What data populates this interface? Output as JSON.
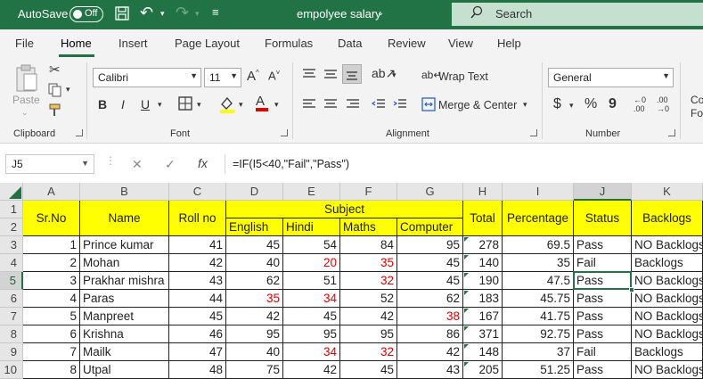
{
  "titlebar": {
    "autosave": "AutoSave",
    "toggle": "Off",
    "title": "empolyee salary",
    "search": "Search"
  },
  "menu": [
    "File",
    "Home",
    "Insert",
    "Page Layout",
    "Formulas",
    "Data",
    "Review",
    "View",
    "Help"
  ],
  "ribbon": {
    "paste": "Paste",
    "clipboard": "Clipboard",
    "font_name": "Calibri",
    "font_size": "11",
    "font_label": "Font",
    "wrap_text": "Wrap Text",
    "merge_center": "Merge & Center",
    "alignment_label": "Alignment",
    "number_format": "General",
    "number_label": "Number",
    "cond_fmt": "Co\nFor",
    "bold": "B",
    "italic": "I",
    "underline": "U",
    "font_color_a": "A",
    "grow_font": "A^",
    "shrink_font": "A˅",
    "currency": "$",
    "percent": "%",
    "comma": "9",
    "inc_dec": ".00",
    "dec_dec": ".00",
    "colors": {
      "highlight": "#ffff00",
      "font_red": "#e00000"
    }
  },
  "formula_bar": {
    "name_box": "J5",
    "formula": "=IF(I5<40,\"Fail\",\"Pass\")",
    "fx": "fx"
  },
  "columns": [
    "A",
    "B",
    "C",
    "D",
    "E",
    "F",
    "G",
    "H",
    "I",
    "J",
    "K"
  ],
  "rows": [
    "1",
    "2",
    "3",
    "4",
    "5",
    "6",
    "7",
    "8",
    "9",
    "10"
  ],
  "headers": {
    "srno": "Sr.No",
    "name": "Name",
    "rollno": "Roll no",
    "subject": "Subject",
    "english": "English",
    "hindi": "Hindi",
    "maths": "Maths",
    "computer": "Computer",
    "total": "Total",
    "percentage": "Percentage",
    "status": "Status",
    "backlogs": "Backlogs"
  },
  "data": [
    {
      "sr": "1",
      "name": "Prince kumar",
      "roll": "41",
      "en": "45",
      "hi": "54",
      "ma": "84",
      "co": "95",
      "total": "278",
      "pct": "69.5",
      "status": "Pass",
      "backlogs": "NO Backlogs"
    },
    {
      "sr": "2",
      "name": "Mohan",
      "roll": "42",
      "en": "40",
      "hi": "20",
      "ma": "35",
      "co": "45",
      "total": "140",
      "pct": "35",
      "status": "Fail",
      "backlogs": "Backlogs"
    },
    {
      "sr": "3",
      "name": "Prakhar mishra",
      "roll": "43",
      "en": "62",
      "hi": "51",
      "ma": "32",
      "co": "45",
      "total": "190",
      "pct": "47.5",
      "status": "Pass",
      "backlogs": "NO Backlogs"
    },
    {
      "sr": "4",
      "name": "Paras",
      "roll": "44",
      "en": "35",
      "hi": "34",
      "ma": "52",
      "co": "62",
      "total": "183",
      "pct": "45.75",
      "status": "Pass",
      "backlogs": "NO Backlogs"
    },
    {
      "sr": "5",
      "name": "Manpreet",
      "roll": "45",
      "en": "42",
      "hi": "45",
      "ma": "42",
      "co": "38",
      "total": "167",
      "pct": "41.75",
      "status": "Pass",
      "backlogs": "NO Backlogs"
    },
    {
      "sr": "6",
      "name": "Krishna",
      "roll": "46",
      "en": "95",
      "hi": "95",
      "ma": "95",
      "co": "86",
      "total": "371",
      "pct": "92.75",
      "status": "Pass",
      "backlogs": "NO Backlogs"
    },
    {
      "sr": "7",
      "name": "Mailk",
      "roll": "47",
      "en": "40",
      "hi": "34",
      "ma": "32",
      "co": "42",
      "total": "148",
      "pct": "37",
      "status": "Fail",
      "backlogs": "Backlogs"
    },
    {
      "sr": "8",
      "name": "Utpal",
      "roll": "48",
      "en": "75",
      "hi": "42",
      "ma": "45",
      "co": "43",
      "total": "205",
      "pct": "51.25",
      "status": "Pass",
      "backlogs": "NO Backlogs"
    }
  ],
  "red_cells": [
    [
      1,
      "hi"
    ],
    [
      1,
      "ma"
    ],
    [
      2,
      "ma"
    ],
    [
      3,
      "en"
    ],
    [
      3,
      "hi"
    ],
    [
      4,
      "co"
    ],
    [
      6,
      "hi"
    ],
    [
      6,
      "ma"
    ]
  ]
}
